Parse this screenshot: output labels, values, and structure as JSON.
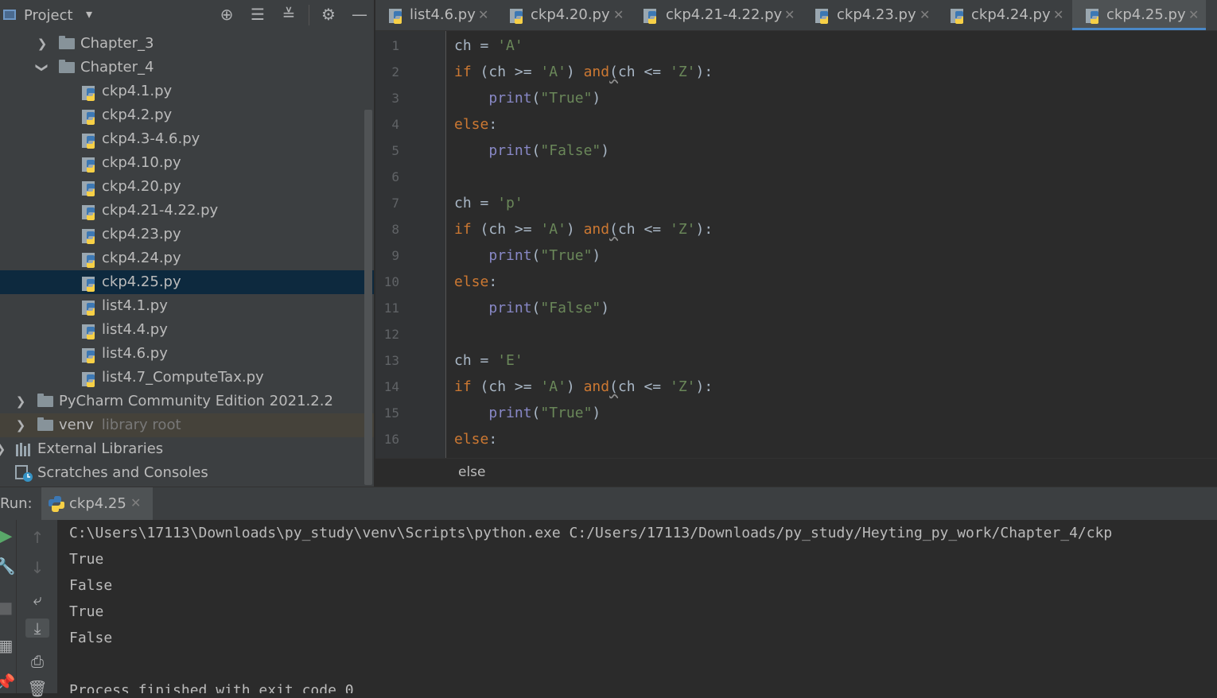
{
  "project_panel": {
    "title": "Project",
    "tree": [
      {
        "label": "Chapter_3",
        "type": "folder",
        "expanded": false
      },
      {
        "label": "Chapter_4",
        "type": "folder",
        "expanded": true
      },
      {
        "label": "ckp4.1.py",
        "type": "py"
      },
      {
        "label": "ckp4.2.py",
        "type": "py"
      },
      {
        "label": "ckp4.3-4.6.py",
        "type": "py"
      },
      {
        "label": "ckp4.10.py",
        "type": "py"
      },
      {
        "label": "ckp4.20.py",
        "type": "py"
      },
      {
        "label": "ckp4.21-4.22.py",
        "type": "py"
      },
      {
        "label": "ckp4.23.py",
        "type": "py"
      },
      {
        "label": "ckp4.24.py",
        "type": "py"
      },
      {
        "label": "ckp4.25.py",
        "type": "py",
        "selected": true
      },
      {
        "label": "list4.1.py",
        "type": "py"
      },
      {
        "label": "list4.4.py",
        "type": "py"
      },
      {
        "label": "list4.6.py",
        "type": "py"
      },
      {
        "label": "list4.7_ComputeTax.py",
        "type": "py"
      },
      {
        "label": "PyCharm Community Edition 2021.2.2",
        "type": "folder",
        "expanded": false
      },
      {
        "label": "venv",
        "hint": "library root",
        "type": "folder",
        "expanded": false
      },
      {
        "label": "External Libraries",
        "type": "libraries"
      },
      {
        "label": "Scratches and Consoles",
        "type": "scratches"
      }
    ]
  },
  "editor_tabs": [
    {
      "label": "list4.6.py",
      "active": false
    },
    {
      "label": "ckp4.20.py",
      "active": false
    },
    {
      "label": "ckp4.21-4.22.py",
      "active": false
    },
    {
      "label": "ckp4.23.py",
      "active": false
    },
    {
      "label": "ckp4.24.py",
      "active": false
    },
    {
      "label": "ckp4.25.py",
      "active": true
    }
  ],
  "editor": {
    "line_numbers": [
      "1",
      "2",
      "3",
      "4",
      "5",
      "6",
      "7",
      "8",
      "9",
      "10",
      "11",
      "12",
      "13",
      "14",
      "15",
      "16"
    ],
    "lines": [
      "ch = 'A'",
      "if (ch >= 'A') and(ch <= 'Z'):",
      "    print(\"True\")",
      "else:",
      "    print(\"False\")",
      "",
      "ch = 'p'",
      "if (ch >= 'A') and(ch <= 'Z'):",
      "    print(\"True\")",
      "else:",
      "    print(\"False\")",
      "",
      "ch = 'E'",
      "if (ch >= 'A') and(ch <= 'Z'):",
      "    print(\"True\")",
      "else:"
    ],
    "breadcrumb": "else"
  },
  "run_panel": {
    "label": "Run:",
    "tab_label": "ckp4.25",
    "console_lines": [
      "C:\\Users\\17113\\Downloads\\py_study\\venv\\Scripts\\python.exe C:/Users/17113/Downloads/py_study/Heyting_py_work/Chapter_4/ckp",
      "True",
      "False",
      "True",
      "False",
      "",
      "Process finished with exit code 0"
    ]
  },
  "colors": {
    "keyword": "#cc7832",
    "string": "#6a8759",
    "builtin": "#8888c6",
    "selection": "#0d293e",
    "tab_underline": "#4a88c7"
  }
}
